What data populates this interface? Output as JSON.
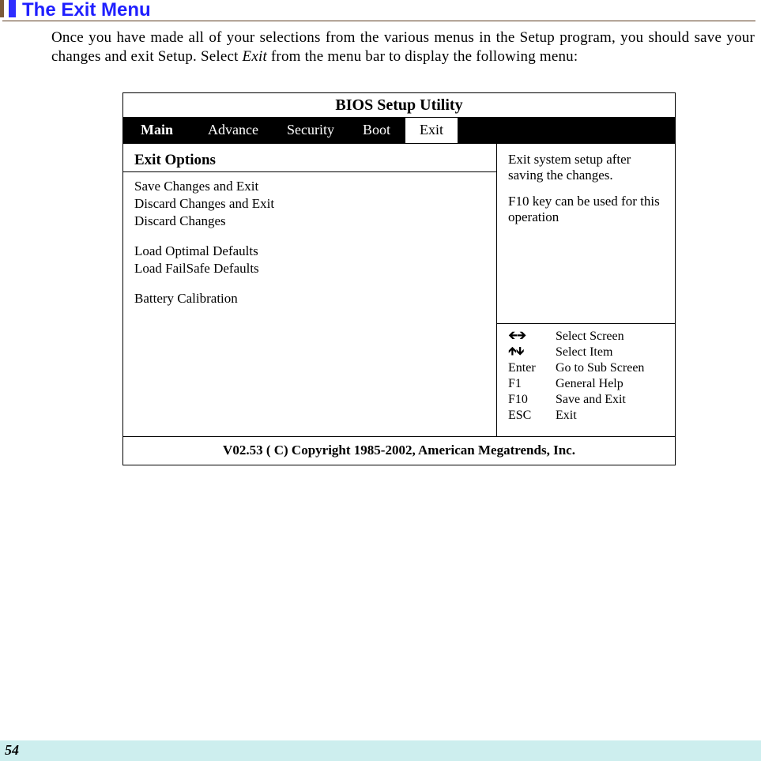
{
  "page": {
    "title": "The Exit Menu",
    "body_prefix": "Once you have made all of your selections from the various menus in the Setup program, you should save your changes and exit Setup.  Select ",
    "body_italic": "Exit",
    "body_suffix": " from the menu bar to display the following menu:",
    "page_number": "54"
  },
  "bios": {
    "title": "BIOS  Setup  Utility",
    "tabs": {
      "main": "Main",
      "advance": "Advance",
      "security": "Security",
      "boot": "Boot",
      "exit": "Exit"
    },
    "left": {
      "heading": "Exit  Options",
      "items": [
        "Save Changes and Exit",
        "Discard Changes and Exit",
        "Discard Changes",
        "",
        "Load Optimal Defaults",
        "Load FailSafe Defaults",
        "",
        "Battery Calibration"
      ]
    },
    "right": {
      "help1": "Exit system setup after saving the changes.",
      "help2": "F10 key can be used for this operation",
      "nav": [
        {
          "key": "←→",
          "label": "Select Screen"
        },
        {
          "key": "↑↓",
          "label": "Select Item"
        },
        {
          "key": "Enter",
          "label": "Go to Sub Screen"
        },
        {
          "key": "F1",
          "label": "General Help"
        },
        {
          "key": "F10",
          "label": "Save and Exit"
        },
        {
          "key": "ESC",
          "label": "Exit"
        }
      ]
    },
    "footer": "V02.53  ( C) Copyright 1985-2002, American Megatrends, Inc."
  }
}
